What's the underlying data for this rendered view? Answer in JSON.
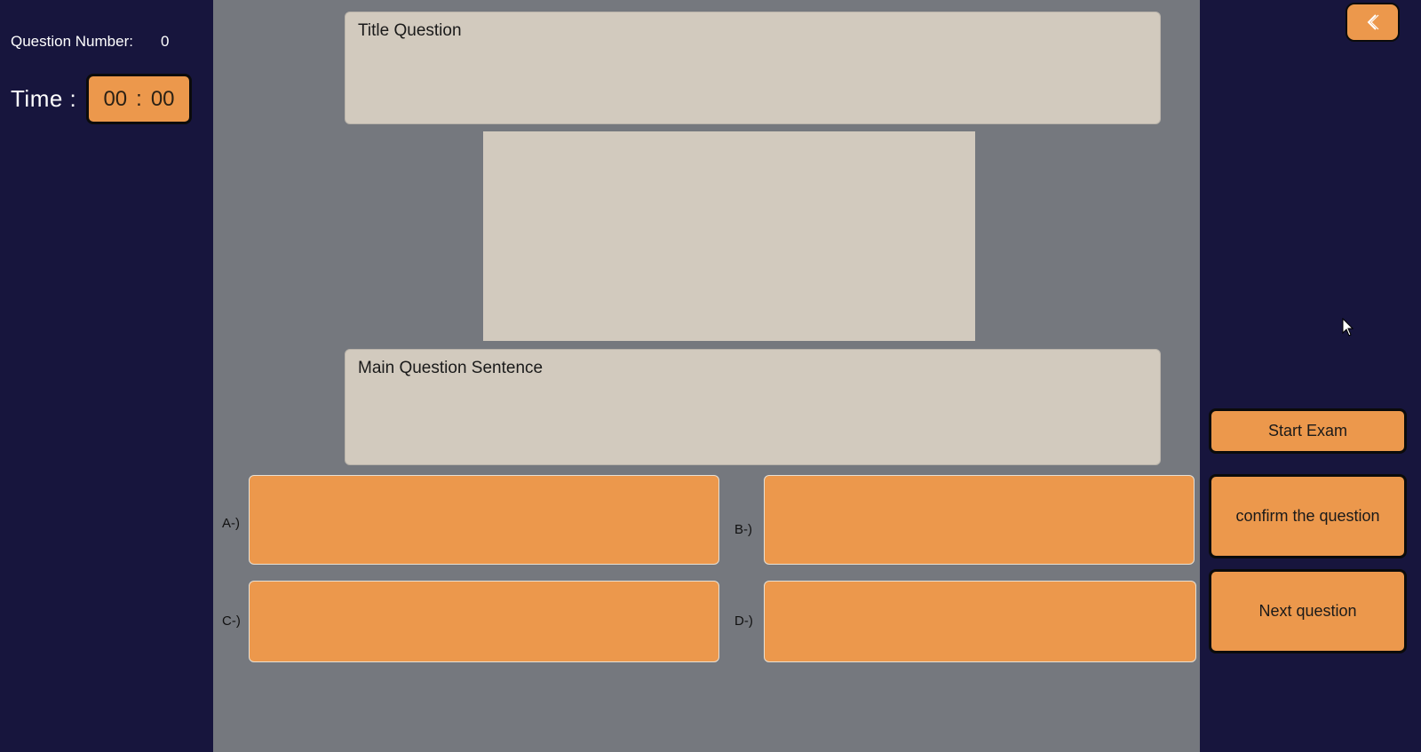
{
  "sidebar": {
    "question_number_label": "Question Number:",
    "question_number_value": "0",
    "time_label": "Time :",
    "timer": {
      "minutes": "00",
      "separator": ":",
      "seconds": "00"
    }
  },
  "question": {
    "title_placeholder": "Title Question",
    "sentence_placeholder": "Main Question Sentence"
  },
  "options": [
    {
      "label": "A-)",
      "value": ""
    },
    {
      "label": "B-)",
      "value": ""
    },
    {
      "label": "C-)",
      "value": ""
    },
    {
      "label": "D-)",
      "value": ""
    }
  ],
  "actions": {
    "back_icon": "chevron-left-icon",
    "start_label": "Start Exam",
    "confirm_label": "confirm the question",
    "next_label": "Next question"
  },
  "colors": {
    "background": "#17153d",
    "panel": "#75787e",
    "field": "#d2cabe",
    "accent": "#ec984c"
  }
}
